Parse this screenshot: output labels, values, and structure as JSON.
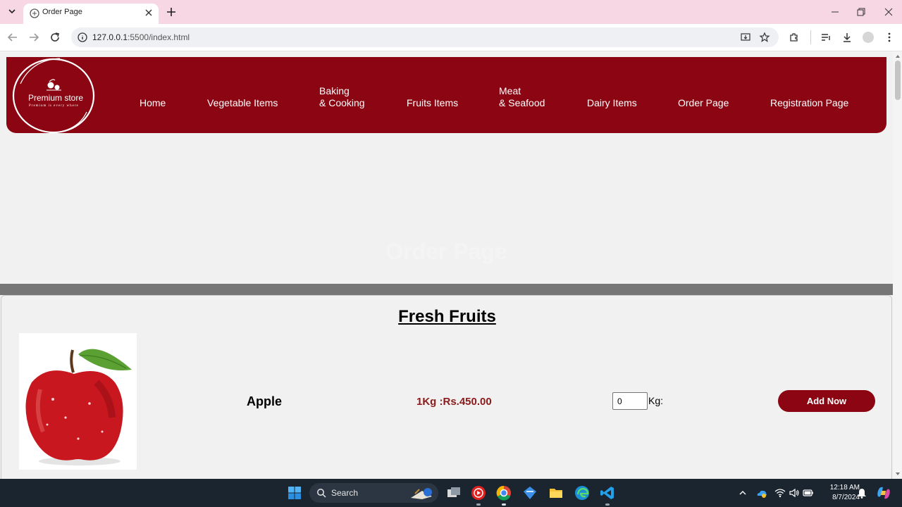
{
  "browser": {
    "tab_title": "Order Page",
    "url_host": "127.0.0.1",
    "url_rest": ":5500/index.html"
  },
  "site": {
    "logo": {
      "title": "Premium store",
      "tagline": "Premium is every where"
    },
    "nav": [
      {
        "line1": "Home",
        "line2": ""
      },
      {
        "line1": "Vegetable Items",
        "line2": ""
      },
      {
        "line1": "Baking",
        "line2": "& Cooking"
      },
      {
        "line1": "Fruits Items",
        "line2": ""
      },
      {
        "line1": "Meat",
        "line2": "& Seafood"
      },
      {
        "line1": "Dairy Items",
        "line2": ""
      },
      {
        "line1": "Order Page",
        "line2": ""
      },
      {
        "line1": "Registration Page",
        "line2": ""
      }
    ],
    "hero_title": "Order Page",
    "section_title": "Fresh Fruits",
    "product": {
      "name": "Apple",
      "price": "1Kg :Rs.450.00",
      "quantity_value": "0",
      "unit_label": "Kg:",
      "button_label": "Add Now"
    },
    "colors": {
      "brand": "#8b0612",
      "price": "#8b1a1a"
    }
  },
  "taskbar": {
    "search_label": "Search",
    "time": "12:18 AM",
    "date": "8/7/2024"
  }
}
